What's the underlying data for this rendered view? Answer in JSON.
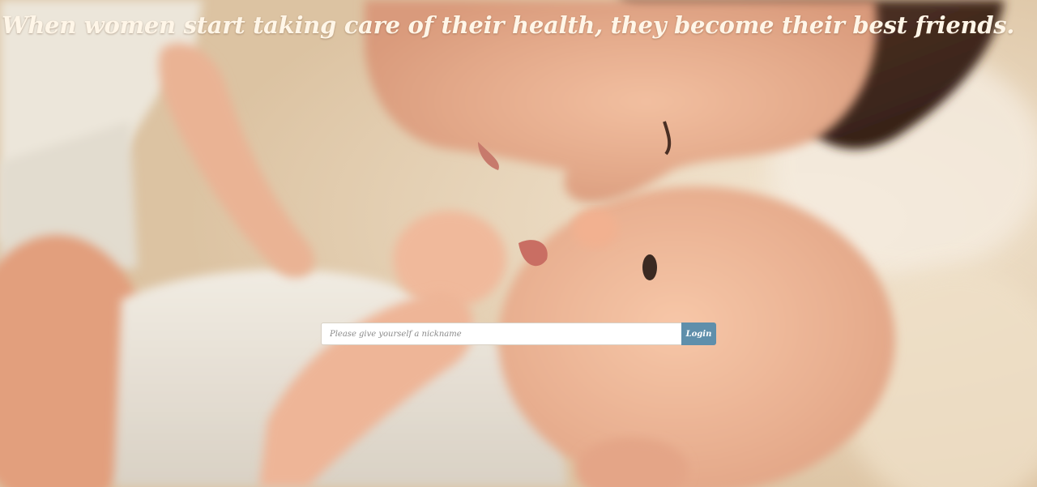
{
  "hero": {
    "tagline": "When women start taking care of their health, they become their best friends."
  },
  "login": {
    "nickname_placeholder": "Please give yourself a nickname",
    "nickname_value": "",
    "button_label": "Login"
  },
  "colors": {
    "tagline_text": "#fff6e8",
    "button_background": "#5f8fab",
    "button_text": "#ffffff",
    "input_background": "#ffffff"
  }
}
